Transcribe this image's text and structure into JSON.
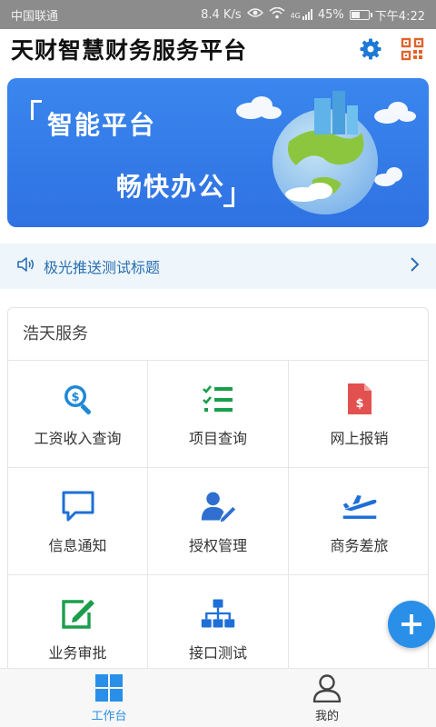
{
  "status_bar": {
    "carrier": "中国联通",
    "speed": "8.4 K/s",
    "network": "4G",
    "battery": "45%",
    "time": "下午4:22"
  },
  "header": {
    "title": "天财智慧财务服务平台",
    "settings_icon": "gear-icon",
    "qr_icon": "qr-code-icon"
  },
  "banner": {
    "line1": "智能平台",
    "line2": "畅快办公"
  },
  "notice": {
    "text": "极光推送测试标题"
  },
  "services": {
    "title": "浩天服务",
    "items": [
      {
        "label": "工资收入查询",
        "icon": "salary-search-icon",
        "color": "#1e88d6"
      },
      {
        "label": "项目查询",
        "icon": "checklist-icon",
        "color": "#1a9e4b"
      },
      {
        "label": "网上报销",
        "icon": "document-icon",
        "color": "#e35050"
      },
      {
        "label": "信息通知",
        "icon": "message-icon",
        "color": "#1e70d6"
      },
      {
        "label": "授权管理",
        "icon": "user-edit-icon",
        "color": "#2e6fd0"
      },
      {
        "label": "商务差旅",
        "icon": "airplane-icon",
        "color": "#1e6fd6"
      },
      {
        "label": "业务审批",
        "icon": "approval-edit-icon",
        "color": "#1a9e4b"
      },
      {
        "label": "接口测试",
        "icon": "hierarchy-icon",
        "color": "#1e70d6"
      }
    ]
  },
  "bottom_nav": {
    "items": [
      {
        "label": "工作台",
        "icon": "grid-icon",
        "active": true
      },
      {
        "label": "我的",
        "icon": "user-icon",
        "active": false
      }
    ]
  },
  "colors": {
    "accent": "#2a8fe8",
    "banner": "#3a86ee",
    "notice_bg": "#eef6fc",
    "notice_text": "#2a6fb0"
  }
}
